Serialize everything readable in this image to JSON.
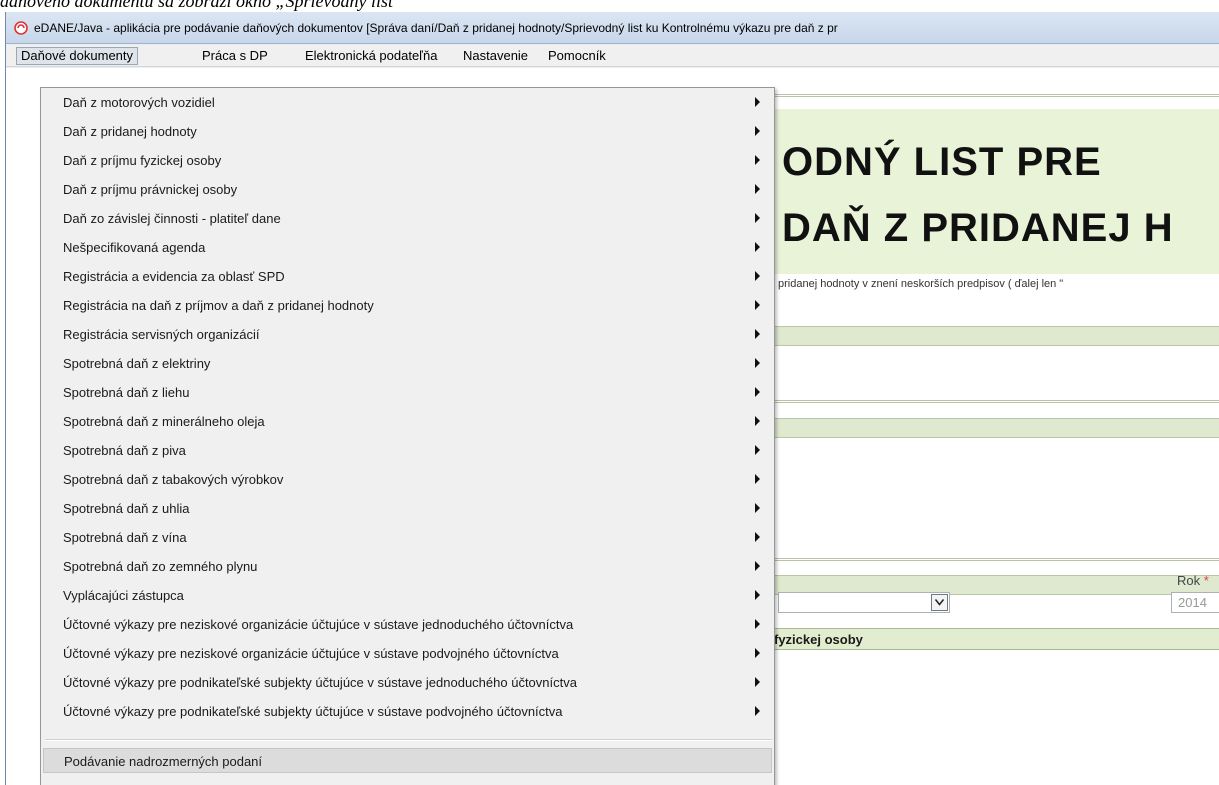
{
  "window": {
    "title": "eDANE/Java - aplikácia pre podávanie daňových dokumentov [Správa daní/Daň z pridanej hodnoty/Sprievodný list ku Kontrolnému výkazu pre daň z pr"
  },
  "menubar": {
    "items": [
      "Daňové dokumenty",
      "Práca s DP",
      "Elektronická podateľňa",
      "Nastavenie",
      "Pomocník"
    ]
  },
  "dropdown": {
    "items": [
      "Daň z motorových vozidiel",
      "Daň z pridanej hodnoty",
      "Daň z príjmu fyzickej osoby",
      "Daň z príjmu právnickej osoby",
      "Daň zo závislej činnosti - platiteľ dane",
      "Nešpecifikovaná agenda",
      "Registrácia a evidencia za oblasť SPD",
      "Registrácia na daň z príjmov a daň z pridanej hodnoty",
      "Registrácia servisných organizácií",
      "Spotrebná daň z elektriny",
      "Spotrebná daň z liehu",
      "Spotrebná daň z minerálneho oleja",
      "Spotrebná daň z piva",
      "Spotrebná daň z tabakových výrobkov",
      "Spotrebná daň z uhlia",
      "Spotrebná daň z vína",
      "Spotrebná daň zo zemného plynu",
      "Vyplácajúci zástupca",
      "Účtovné výkazy pre neziskové organizácie účtujúce v sústave jednoduchého účtovníctva",
      "Účtovné výkazy pre neziskové organizácie účtujúce v sústave podvojného účtovníctva",
      "Účtovné výkazy pre podnikateľské subjekty účtujúce v sústave jednoduchého účtovníctva",
      "Účtovné výkazy pre podnikateľské subjekty účtujúce v sústave podvojného účtovníctva"
    ],
    "bottom_item": "Podávanie nadrozmerných podaní"
  },
  "form": {
    "title_line1": "ODNÝ LIST PRE",
    "title_line2": "DAŇ Z PRIDANEJ H",
    "law_text": "pridanej hodnoty v znení neskorších predpisov ( ďalej len \"",
    "rok_label": "Rok",
    "rok_required_mark": "*",
    "rok_value": "2014",
    "person_section": "fyzickej osoby"
  },
  "colors": {
    "form_green": "#e9f3d8",
    "menu_bg": "#f0f0f0",
    "title_bar": "#c7d7ea"
  }
}
